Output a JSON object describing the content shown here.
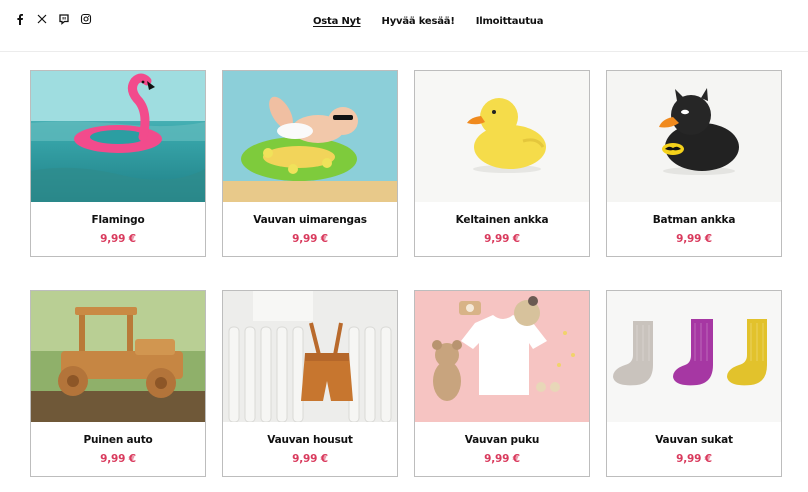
{
  "header": {
    "social": [
      {
        "name": "facebook-icon"
      },
      {
        "name": "x-icon"
      },
      {
        "name": "discord-icon"
      },
      {
        "name": "instagram-icon"
      }
    ],
    "nav": [
      {
        "label": "Osta Nyt",
        "active": true
      },
      {
        "label": "Hyvää kesää!",
        "active": false
      },
      {
        "label": "Ilmoittautua",
        "active": false
      }
    ]
  },
  "products": [
    {
      "name": "Flamingo",
      "price": "9,99 €",
      "image": "flamingo-float-photo"
    },
    {
      "name": "Vauvan uimarengas",
      "price": "9,99 €",
      "image": "baby-swim-ring-photo"
    },
    {
      "name": "Keltainen ankka",
      "price": "9,99 €",
      "image": "yellow-rubber-duck-photo"
    },
    {
      "name": "Batman ankka",
      "price": "9,99 €",
      "image": "batman-rubber-duck-photo"
    },
    {
      "name": "Puinen auto",
      "price": "9,99 €",
      "image": "wooden-car-photo"
    },
    {
      "name": "Vauvan housut",
      "price": "9,99 €",
      "image": "baby-pants-photo"
    },
    {
      "name": "Vauvan puku",
      "price": "9,99 €",
      "image": "baby-outfit-photo"
    },
    {
      "name": "Vauvan sukat",
      "price": "9,99 €",
      "image": "baby-socks-photo"
    }
  ],
  "colors": {
    "price": "#d93a5d",
    "border": "#bdbdbd"
  }
}
